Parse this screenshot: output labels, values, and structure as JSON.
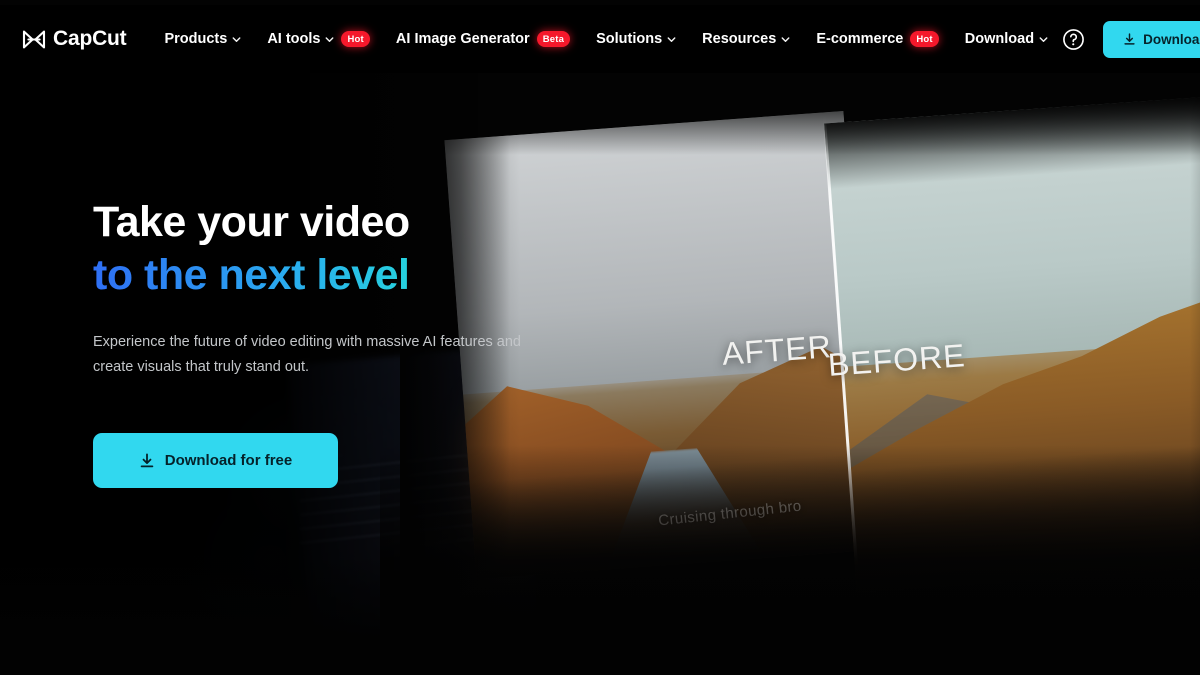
{
  "brand": {
    "name": "CapCut",
    "logo_icon": "capcut-bowtie-logo"
  },
  "nav": {
    "items": [
      {
        "label": "Products",
        "has_chevron": true,
        "badge": null
      },
      {
        "label": "AI tools",
        "has_chevron": true,
        "badge": "Hot"
      },
      {
        "label": "AI Image Generator",
        "has_chevron": false,
        "badge": "Beta"
      },
      {
        "label": "Solutions",
        "has_chevron": true,
        "badge": null
      },
      {
        "label": "Resources",
        "has_chevron": true,
        "badge": null
      },
      {
        "label": "E-commerce",
        "has_chevron": false,
        "badge": "Hot"
      },
      {
        "label": "Download",
        "has_chevron": true,
        "badge": null
      }
    ],
    "help_icon": "question-mark-circle-icon",
    "download_button": {
      "label": "Download",
      "icon": "download-icon"
    }
  },
  "hero": {
    "headline_line1": "Take your video",
    "headline_line2": "to the next level",
    "subcopy": "Experience the future of video editing with massive AI features and create visuals that truly stand out.",
    "cta": {
      "label": "Download for free",
      "icon": "download-icon"
    }
  },
  "comparison": {
    "after_label": "AFTER",
    "before_label": "BEFORE",
    "caption": "Cruising through bro"
  },
  "colors": {
    "accent_cyan": "#31d8ef",
    "badge_red": "#f5182b",
    "background": "#030303",
    "headline_white": "#ffffff",
    "gradient_start": "#2f6ff5",
    "gradient_end": "#2ae9cf",
    "subcopy_gray": "#c3c6c9"
  }
}
